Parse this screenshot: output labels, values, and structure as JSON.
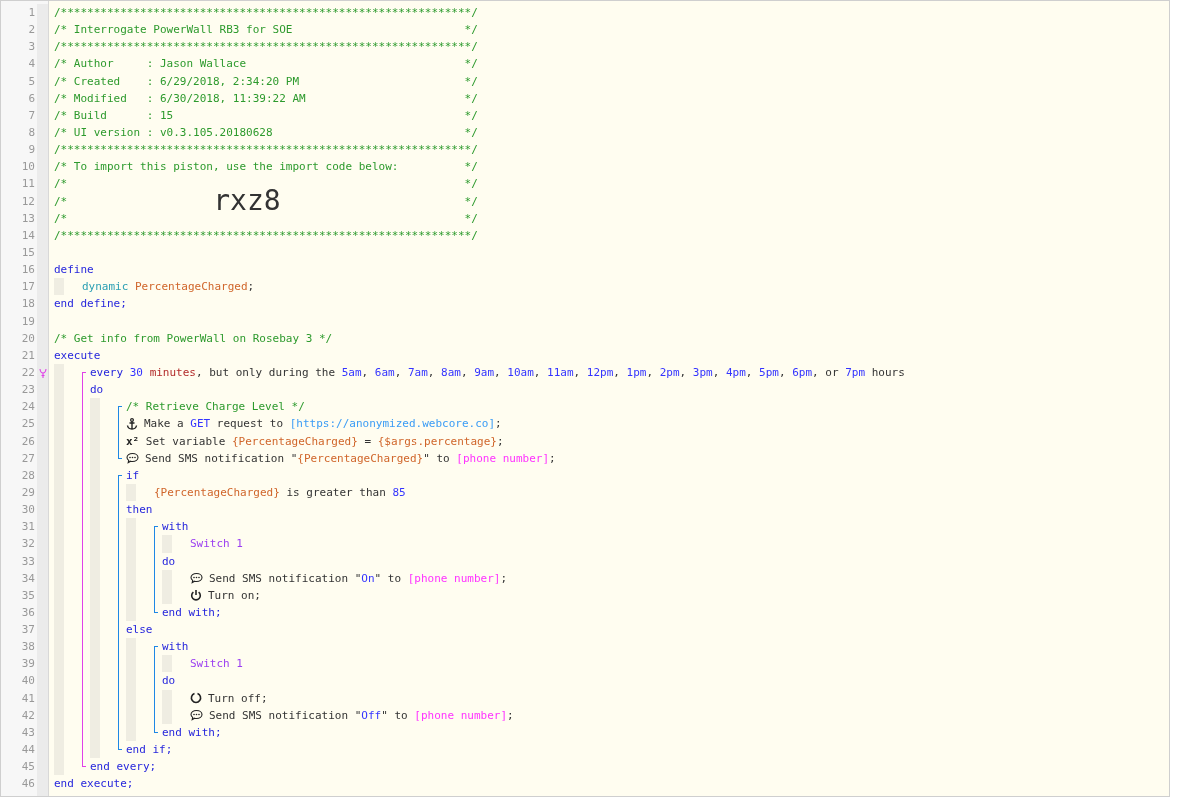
{
  "editor": {
    "lines": [
      {
        "kind": "line",
        "number": "1",
        "segments": [
          {
            "kind": "comment",
            "text": "/**************************************************************/"
          }
        ]
      },
      {
        "kind": "line",
        "number": "2",
        "segments": [
          {
            "kind": "comment",
            "text": "/* Interrogate PowerWall RB3 for SOE                          */"
          }
        ]
      },
      {
        "kind": "line",
        "number": "3",
        "segments": [
          {
            "kind": "comment",
            "text": "/**************************************************************/"
          }
        ]
      },
      {
        "kind": "line",
        "number": "4",
        "segments": [
          {
            "kind": "comment",
            "text": "/* Author     : Jason Wallace                                 */"
          }
        ]
      },
      {
        "kind": "line",
        "number": "5",
        "segments": [
          {
            "kind": "comment",
            "text": "/* Created    : 6/29/2018, 2:34:20 PM                         */"
          }
        ]
      },
      {
        "kind": "line",
        "number": "6",
        "segments": [
          {
            "kind": "comment",
            "text": "/* Modified   : 6/30/2018, 11:39:22 AM                        */"
          }
        ]
      },
      {
        "kind": "line",
        "number": "7",
        "segments": [
          {
            "kind": "comment",
            "text": "/* Build      : 15                                            */"
          }
        ]
      },
      {
        "kind": "line",
        "number": "8",
        "segments": [
          {
            "kind": "comment",
            "text": "/* UI version : v0.3.105.20180628                             */"
          }
        ]
      },
      {
        "kind": "line",
        "number": "9",
        "segments": [
          {
            "kind": "comment",
            "text": "/**************************************************************/"
          }
        ]
      },
      {
        "kind": "line",
        "number": "10",
        "segments": [
          {
            "kind": "comment",
            "text": "/* To import this piston, use the import code below:          */"
          }
        ]
      },
      {
        "kind": "line",
        "number": "11",
        "segments": [
          {
            "kind": "comment",
            "text": "/*                                                            */"
          }
        ]
      },
      {
        "kind": "line",
        "number": "12",
        "segments": [
          {
            "kind": "comment",
            "text": "/*"
          },
          {
            "kind": "import-code",
            "text": "rxz8"
          },
          {
            "kind": "comment",
            "text": "*/"
          }
        ]
      },
      {
        "kind": "line",
        "number": "13",
        "segments": [
          {
            "kind": "comment",
            "text": "/*                                                            */"
          }
        ]
      },
      {
        "kind": "line",
        "number": "14",
        "segments": [
          {
            "kind": "comment",
            "text": "/**************************************************************/"
          }
        ]
      },
      {
        "kind": "line",
        "number": "15"
      },
      {
        "kind": "line",
        "number": "16",
        "segments": [
          {
            "kind": "keyword",
            "text": "define"
          }
        ],
        "children": [
          {
            "kind": "line",
            "number": "17",
            "segments": [
              {
                "kind": "type",
                "text": "dynamic "
              },
              {
                "kind": "variable",
                "text": "PercentageCharged"
              },
              {
                "kind": "plain",
                "text": ";"
              }
            ]
          }
        ]
      },
      {
        "kind": "line",
        "number": "18",
        "segments": [
          {
            "kind": "keyword",
            "text": "end define;"
          }
        ]
      },
      {
        "kind": "line",
        "number": "19"
      },
      {
        "kind": "line",
        "number": "20",
        "segments": [
          {
            "kind": "comment",
            "text": "/* Get info from PowerWall on Rosebay 3 */"
          }
        ]
      },
      {
        "kind": "line",
        "number": "21",
        "segments": [
          {
            "kind": "keyword",
            "text": "execute"
          }
        ],
        "children": [
          {
            "kind": "group",
            "color": "#e040e8",
            "items": [
              {
                "kind": "line",
                "number": "22",
                "trigger": true,
                "segments": [
                  {
                    "kind": "keyword",
                    "text": "every "
                  },
                  {
                    "kind": "value",
                    "text": "30 "
                  },
                  {
                    "kind": "unit",
                    "text": "minutes"
                  },
                  {
                    "kind": "plain",
                    "text": ", but only during the "
                  },
                  {
                    "kind": "value",
                    "text": "5am"
                  },
                  {
                    "kind": "plain",
                    "text": ", "
                  },
                  {
                    "kind": "value",
                    "text": "6am"
                  },
                  {
                    "kind": "plain",
                    "text": ", "
                  },
                  {
                    "kind": "value",
                    "text": "7am"
                  },
                  {
                    "kind": "plain",
                    "text": ", "
                  },
                  {
                    "kind": "value",
                    "text": "8am"
                  },
                  {
                    "kind": "plain",
                    "text": ", "
                  },
                  {
                    "kind": "value",
                    "text": "9am"
                  },
                  {
                    "kind": "plain",
                    "text": ", "
                  },
                  {
                    "kind": "value",
                    "text": "10am"
                  },
                  {
                    "kind": "plain",
                    "text": ", "
                  },
                  {
                    "kind": "value",
                    "text": "11am"
                  },
                  {
                    "kind": "plain",
                    "text": ", "
                  },
                  {
                    "kind": "value",
                    "text": "12pm"
                  },
                  {
                    "kind": "plain",
                    "text": ", "
                  },
                  {
                    "kind": "value",
                    "text": "1pm"
                  },
                  {
                    "kind": "plain",
                    "text": ", "
                  },
                  {
                    "kind": "value",
                    "text": "2pm"
                  },
                  {
                    "kind": "plain",
                    "text": ", "
                  },
                  {
                    "kind": "value",
                    "text": "3pm"
                  },
                  {
                    "kind": "plain",
                    "text": ", "
                  },
                  {
                    "kind": "value",
                    "text": "4pm"
                  },
                  {
                    "kind": "plain",
                    "text": ", "
                  },
                  {
                    "kind": "value",
                    "text": "5pm"
                  },
                  {
                    "kind": "plain",
                    "text": ", "
                  },
                  {
                    "kind": "value",
                    "text": "6pm"
                  },
                  {
                    "kind": "plain",
                    "text": ", or "
                  },
                  {
                    "kind": "value",
                    "text": "7pm"
                  },
                  {
                    "kind": "plain",
                    "text": " hours"
                  }
                ]
              },
              {
                "kind": "line",
                "number": "23",
                "segments": [
                  {
                    "kind": "keyword",
                    "text": "do"
                  }
                ],
                "children": [
                  {
                    "kind": "group",
                    "color": "#1e88e5",
                    "items": [
                      {
                        "kind": "line",
                        "number": "24",
                        "segments": [
                          {
                            "kind": "comment",
                            "text": "/* Retrieve Charge Level */"
                          }
                        ]
                      },
                      {
                        "kind": "http_request",
                        "number": "25",
                        "segments": [
                          {
                            "kind": "plain",
                            "text": "Make a "
                          },
                          {
                            "kind": "value",
                            "text": "GET"
                          },
                          {
                            "kind": "plain",
                            "text": " request to "
                          },
                          {
                            "kind": "url",
                            "text": "[https://anonymized.webcore.co]"
                          },
                          {
                            "kind": "plain",
                            "text": ";"
                          }
                        ]
                      },
                      {
                        "kind": "line",
                        "number": "26",
                        "segments": [
                          {
                            "kind": "symbol",
                            "text": "x²"
                          },
                          {
                            "kind": "plain",
                            "text": " Set variable "
                          },
                          {
                            "kind": "variable",
                            "text": "{PercentageCharged}"
                          },
                          {
                            "kind": "plain",
                            "text": " = "
                          },
                          {
                            "kind": "variable",
                            "text": "{$args.percentage}"
                          },
                          {
                            "kind": "plain",
                            "text": ";"
                          }
                        ]
                      },
                      {
                        "kind": "notification",
                        "number": "27",
                        "segments": [
                          {
                            "kind": "plain",
                            "text": "Send SMS notification \""
                          },
                          {
                            "kind": "variable",
                            "text": "{PercentageCharged}"
                          },
                          {
                            "kind": "plain",
                            "text": "\" to "
                          },
                          {
                            "kind": "contact",
                            "text": "[phone number]"
                          },
                          {
                            "kind": "plain",
                            "text": ";"
                          }
                        ]
                      }
                    ]
                  },
                  {
                    "kind": "group",
                    "color": "#1e88e5",
                    "items": [
                      {
                        "kind": "line",
                        "number": "28",
                        "segments": [
                          {
                            "kind": "keyword",
                            "text": "if"
                          }
                        ],
                        "children": [
                          {
                            "kind": "line",
                            "number": "29",
                            "segments": [
                              {
                                "kind": "variable",
                                "text": "{PercentageCharged}"
                              },
                              {
                                "kind": "plain",
                                "text": " is greater than "
                              },
                              {
                                "kind": "value",
                                "text": "85"
                              }
                            ]
                          }
                        ]
                      },
                      {
                        "kind": "line",
                        "number": "30",
                        "segments": [
                          {
                            "kind": "keyword",
                            "text": "then"
                          }
                        ],
                        "children": [
                          {
                            "kind": "group",
                            "color": "#1e88e5",
                            "items": [
                              {
                                "kind": "line",
                                "number": "31",
                                "segments": [
                                  {
                                    "kind": "keyword",
                                    "text": "with"
                                  }
                                ],
                                "children": [
                                  {
                                    "kind": "line",
                                    "number": "32",
                                    "segments": [
                                      {
                                        "kind": "device",
                                        "text": "Switch 1"
                                      }
                                    ]
                                  }
                                ]
                              },
                              {
                                "kind": "line",
                                "number": "33",
                                "segments": [
                                  {
                                    "kind": "keyword",
                                    "text": "do"
                                  }
                                ],
                                "children": [
                                  {
                                    "kind": "notification",
                                    "number": "34",
                                    "segments": [
                                      {
                                        "kind": "plain",
                                        "text": "Send SMS notification \""
                                      },
                                      {
                                        "kind": "value",
                                        "text": "On"
                                      },
                                      {
                                        "kind": "plain",
                                        "text": "\" to "
                                      },
                                      {
                                        "kind": "contact",
                                        "text": "[phone number]"
                                      },
                                      {
                                        "kind": "plain",
                                        "text": ";"
                                      }
                                    ]
                                  },
                                  {
                                    "kind": "turn_on",
                                    "number": "35",
                                    "segments": [
                                      {
                                        "kind": "plain",
                                        "text": "Turn on;"
                                      }
                                    ]
                                  }
                                ]
                              },
                              {
                                "kind": "line",
                                "number": "36",
                                "segments": [
                                  {
                                    "kind": "keyword",
                                    "text": "end with;"
                                  }
                                ]
                              }
                            ]
                          }
                        ]
                      },
                      {
                        "kind": "line",
                        "number": "37",
                        "segments": [
                          {
                            "kind": "keyword",
                            "text": "else"
                          }
                        ],
                        "children": [
                          {
                            "kind": "group",
                            "color": "#1e88e5",
                            "items": [
                              {
                                "kind": "line",
                                "number": "38",
                                "segments": [
                                  {
                                    "kind": "keyword",
                                    "text": "with"
                                  }
                                ],
                                "children": [
                                  {
                                    "kind": "line",
                                    "number": "39",
                                    "segments": [
                                      {
                                        "kind": "device",
                                        "text": "Switch 1"
                                      }
                                    ]
                                  }
                                ]
                              },
                              {
                                "kind": "line",
                                "number": "40",
                                "segments": [
                                  {
                                    "kind": "keyword",
                                    "text": "do"
                                  }
                                ],
                                "children": [
                                  {
                                    "kind": "turn_off",
                                    "number": "41",
                                    "segments": [
                                      {
                                        "kind": "plain",
                                        "text": "Turn off;"
                                      }
                                    ]
                                  },
                                  {
                                    "kind": "notification",
                                    "number": "42",
                                    "segments": [
                                      {
                                        "kind": "plain",
                                        "text": "Send SMS notification \""
                                      },
                                      {
                                        "kind": "value",
                                        "text": "Off"
                                      },
                                      {
                                        "kind": "plain",
                                        "text": "\" to "
                                      },
                                      {
                                        "kind": "contact",
                                        "text": "[phone number]"
                                      },
                                      {
                                        "kind": "plain",
                                        "text": ";"
                                      }
                                    ]
                                  }
                                ]
                              },
                              {
                                "kind": "line",
                                "number": "43",
                                "segments": [
                                  {
                                    "kind": "keyword",
                                    "text": "end with;"
                                  }
                                ]
                              }
                            ]
                          }
                        ]
                      },
                      {
                        "kind": "line",
                        "number": "44",
                        "segments": [
                          {
                            "kind": "keyword",
                            "text": "end if;"
                          }
                        ]
                      }
                    ]
                  }
                ]
              },
              {
                "kind": "line",
                "number": "45",
                "segments": [
                  {
                    "kind": "keyword",
                    "text": "end every;"
                  }
                ]
              }
            ]
          }
        ]
      },
      {
        "kind": "line",
        "number": "46",
        "segments": [
          {
            "kind": "keyword",
            "text": "end execute;"
          }
        ]
      }
    ]
  }
}
